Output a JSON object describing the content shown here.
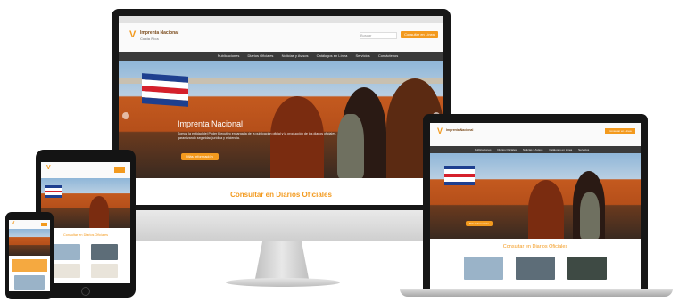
{
  "site": {
    "logo_name": "Imprenta Nacional",
    "logo_sub": "Costa Rica",
    "search_placeholder": "Buscar",
    "cta_button": "Consultar en Línea",
    "nav": [
      "Publicaciones",
      "Diarios Oficiales",
      "Noticias y Avisos",
      "Catálogos en Línea",
      "Servicios",
      "Contáctenos"
    ],
    "hero_title": "Imprenta Nacional",
    "hero_text": "Somos la entidad del Poder Ejecutivo encargada de la publicación oficial y la producción de los diarios oficiales, garantizando seguridad jurídica y eficiencia.",
    "hero_button": "Más Información",
    "section_title": "Consultar en Diarios Oficiales"
  },
  "colors": {
    "accent": "#f39a1e",
    "nav": "#3a3a3a",
    "bezel": "#1a1a1a",
    "silver": "#d9d9d9"
  }
}
